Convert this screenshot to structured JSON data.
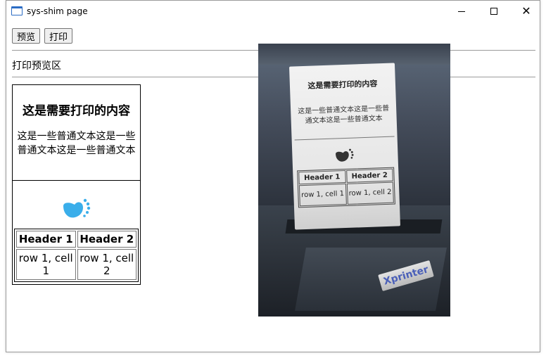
{
  "window": {
    "title": "sys-shim page"
  },
  "toolbar": {
    "preview_label": "预览",
    "print_label": "打印"
  },
  "section": {
    "label": "打印预览区"
  },
  "preview": {
    "heading": "这是需要打印的内容",
    "body_text": "这是一些普通文本这是一些普通文本这是一些普通文本",
    "logo_icon": "footprint-logo-icon",
    "logo_color": "#3aaeea",
    "table": {
      "headers": [
        "Header 1",
        "Header 2"
      ],
      "rows": [
        [
          "row 1, cell 1",
          "row 1, cell 2"
        ]
      ]
    }
  },
  "photo": {
    "receipt": {
      "heading": "这是需要打印的内容",
      "body_text": "这是一些普通文本这是一些普通文本这是一些普通文本",
      "table": {
        "headers": [
          "Header 1",
          "Header 2"
        ],
        "rows": [
          [
            "row 1, cell 1",
            "row 1, cell 2"
          ]
        ]
      }
    },
    "brand": "Xprinter"
  }
}
